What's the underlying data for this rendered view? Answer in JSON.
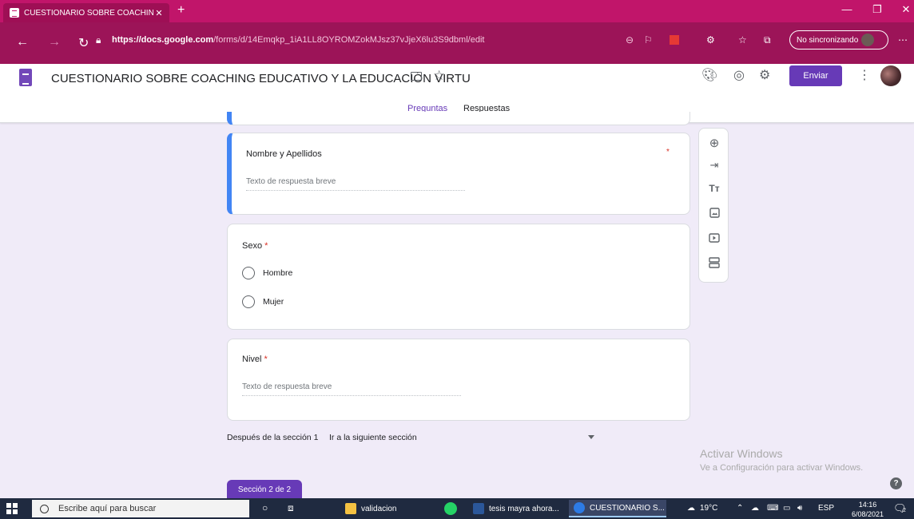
{
  "browser": {
    "tab_title": "CUESTIONARIO SOBRE COACHIN",
    "tab_close": "✕",
    "new_tab": "+",
    "url_domain": "https://docs.google.com",
    "url_path": "/forms/d/14Emqkp_1iA1LL8OYROMZokMJsz37vJjeX6lu3S9dbml/edit",
    "sync_label": "No sincronizando",
    "window_controls": [
      "—",
      "❐",
      "✕"
    ]
  },
  "form": {
    "title": "CUESTIONARIO SOBRE COACHING EDUCATIVO Y LA EDUCACIÓN VIRTU",
    "send_label": "Enviar",
    "tabs": [
      {
        "label": "Preguntas",
        "active": true
      },
      {
        "label": "Respuestas",
        "active": false
      }
    ]
  },
  "questions": [
    {
      "title": "Nombre y Apellidos",
      "placeholder": "Texto de respuesta breve",
      "required_mark": "*"
    },
    {
      "title": "Sexo",
      "required_mark": "*",
      "options": [
        "Hombre",
        "Mujer"
      ]
    },
    {
      "title": "Nivel",
      "required_mark": "*",
      "placeholder": "Texto de respuesta breve"
    }
  ],
  "section_nav": {
    "after_label": "Después de la sección 1",
    "goto_value": "Ir a la siguiente sección",
    "section_badge": "Sección 2 de 2"
  },
  "watermark": {
    "title": "Activar Windows",
    "subtitle": "Ve a Configuración para activar Windows."
  },
  "help_icon": "?",
  "taskbar": {
    "search_placeholder": "Escribe aquí para buscar",
    "apps": [
      {
        "label": "validacion",
        "color": "#f5c242"
      },
      {
        "label": "tesis mayra ahora...",
        "color": "#2b579a"
      },
      {
        "label": "CUESTIONARIO S...",
        "color": "#2d7be5"
      }
    ],
    "weather": "19°C",
    "language": "ESP",
    "time": "14:16",
    "date": "6/08/2021",
    "notification_count": "2"
  },
  "colors": {
    "browser_frame": "#c1156a",
    "accent": "#673ab7",
    "page_bg": "#f0ebf8",
    "active_question": "#4285f4"
  }
}
